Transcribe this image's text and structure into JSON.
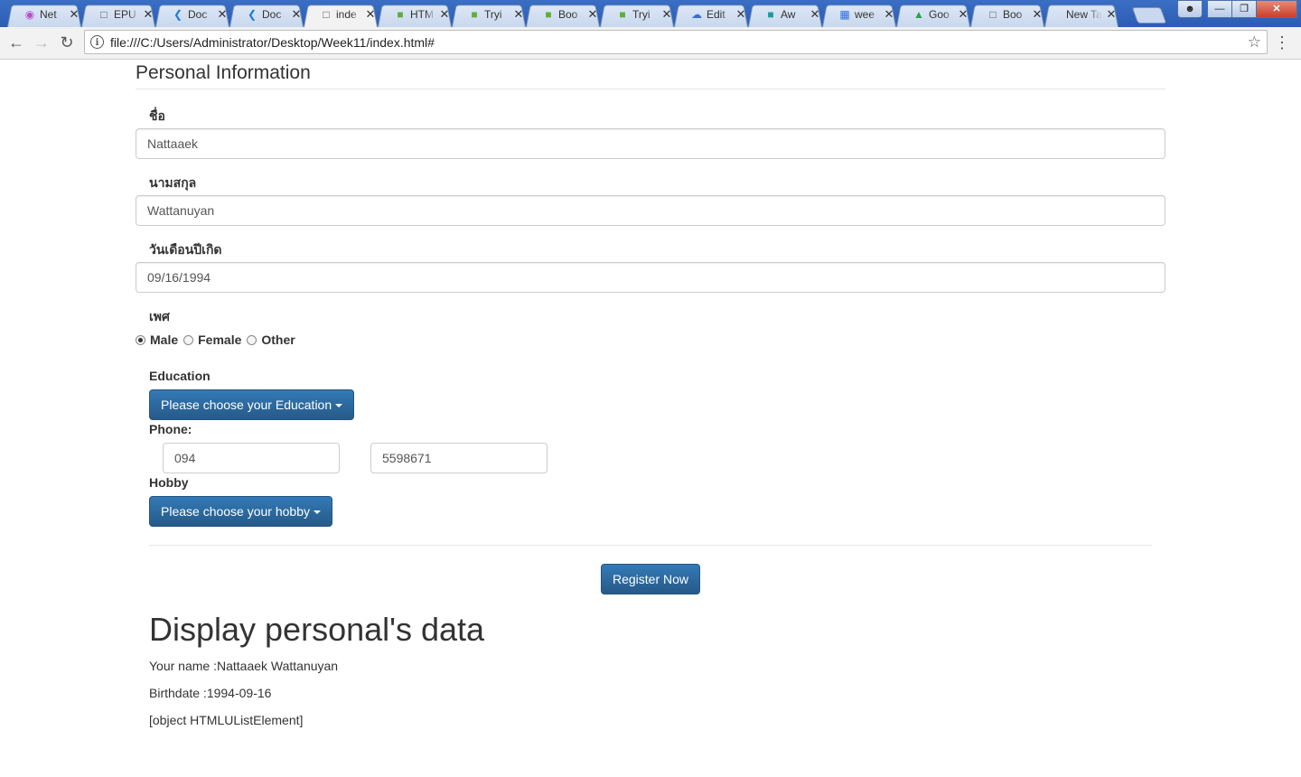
{
  "browser": {
    "tabs": [
      {
        "title": "Net",
        "favicon": "balloon-icon",
        "active": false
      },
      {
        "title": "EPU",
        "favicon": "page-icon",
        "active": false
      },
      {
        "title": "Doc",
        "favicon": "vscode-icon",
        "active": false
      },
      {
        "title": "Doc",
        "favicon": "vscode-icon",
        "active": false
      },
      {
        "title": "inde",
        "favicon": "page-icon",
        "active": true
      },
      {
        "title": "HTM",
        "favicon": "w3-icon",
        "active": false
      },
      {
        "title": "Tryi",
        "favicon": "w3-icon",
        "active": false
      },
      {
        "title": "Boo",
        "favicon": "w3-icon",
        "active": false
      },
      {
        "title": "Tryi",
        "favicon": "w3-icon",
        "active": false
      },
      {
        "title": "Edit",
        "favicon": "cloud-icon",
        "active": false
      },
      {
        "title": "Aw",
        "favicon": "teal-square-icon",
        "active": false
      },
      {
        "title": "wee",
        "favicon": "table-icon",
        "active": false
      },
      {
        "title": "Goo",
        "favicon": "drive-icon",
        "active": false
      },
      {
        "title": "Boo",
        "favicon": "page-icon",
        "active": false
      },
      {
        "title": "New Tab",
        "favicon": "",
        "active": false
      }
    ],
    "url": "file:///C:/Users/Administrator/Desktop/Week11/index.html#"
  },
  "form": {
    "legend": "Personal Information",
    "first_name_label": "ชื่อ",
    "first_name_value": "Nattaaek",
    "last_name_label": "นามสกุล",
    "last_name_value": "Wattanuyan",
    "birthdate_label": "วันเดือนปีเกิด",
    "birthdate_value": "09/16/1994",
    "gender_label": "เพศ",
    "gender_options": [
      "Male",
      "Female",
      "Other"
    ],
    "gender_selected": "Male",
    "education_label": "Education",
    "education_button": "Please choose your Education",
    "phone_label": "Phone:",
    "phone_prefix": "094",
    "phone_number": "5598671",
    "hobby_label": "Hobby",
    "hobby_button": "Please choose your hobby",
    "submit_label": "Register Now"
  },
  "display": {
    "title": "Display personal's data",
    "name_line": "Your name :Nattaaek Wattanuyan",
    "birth_line": "Birthdate :1994-09-16",
    "hobby_line": "[object HTMLUListElement]"
  },
  "colors": {
    "primary": "#337ab7",
    "tabstrip": "#2a5cb3"
  }
}
